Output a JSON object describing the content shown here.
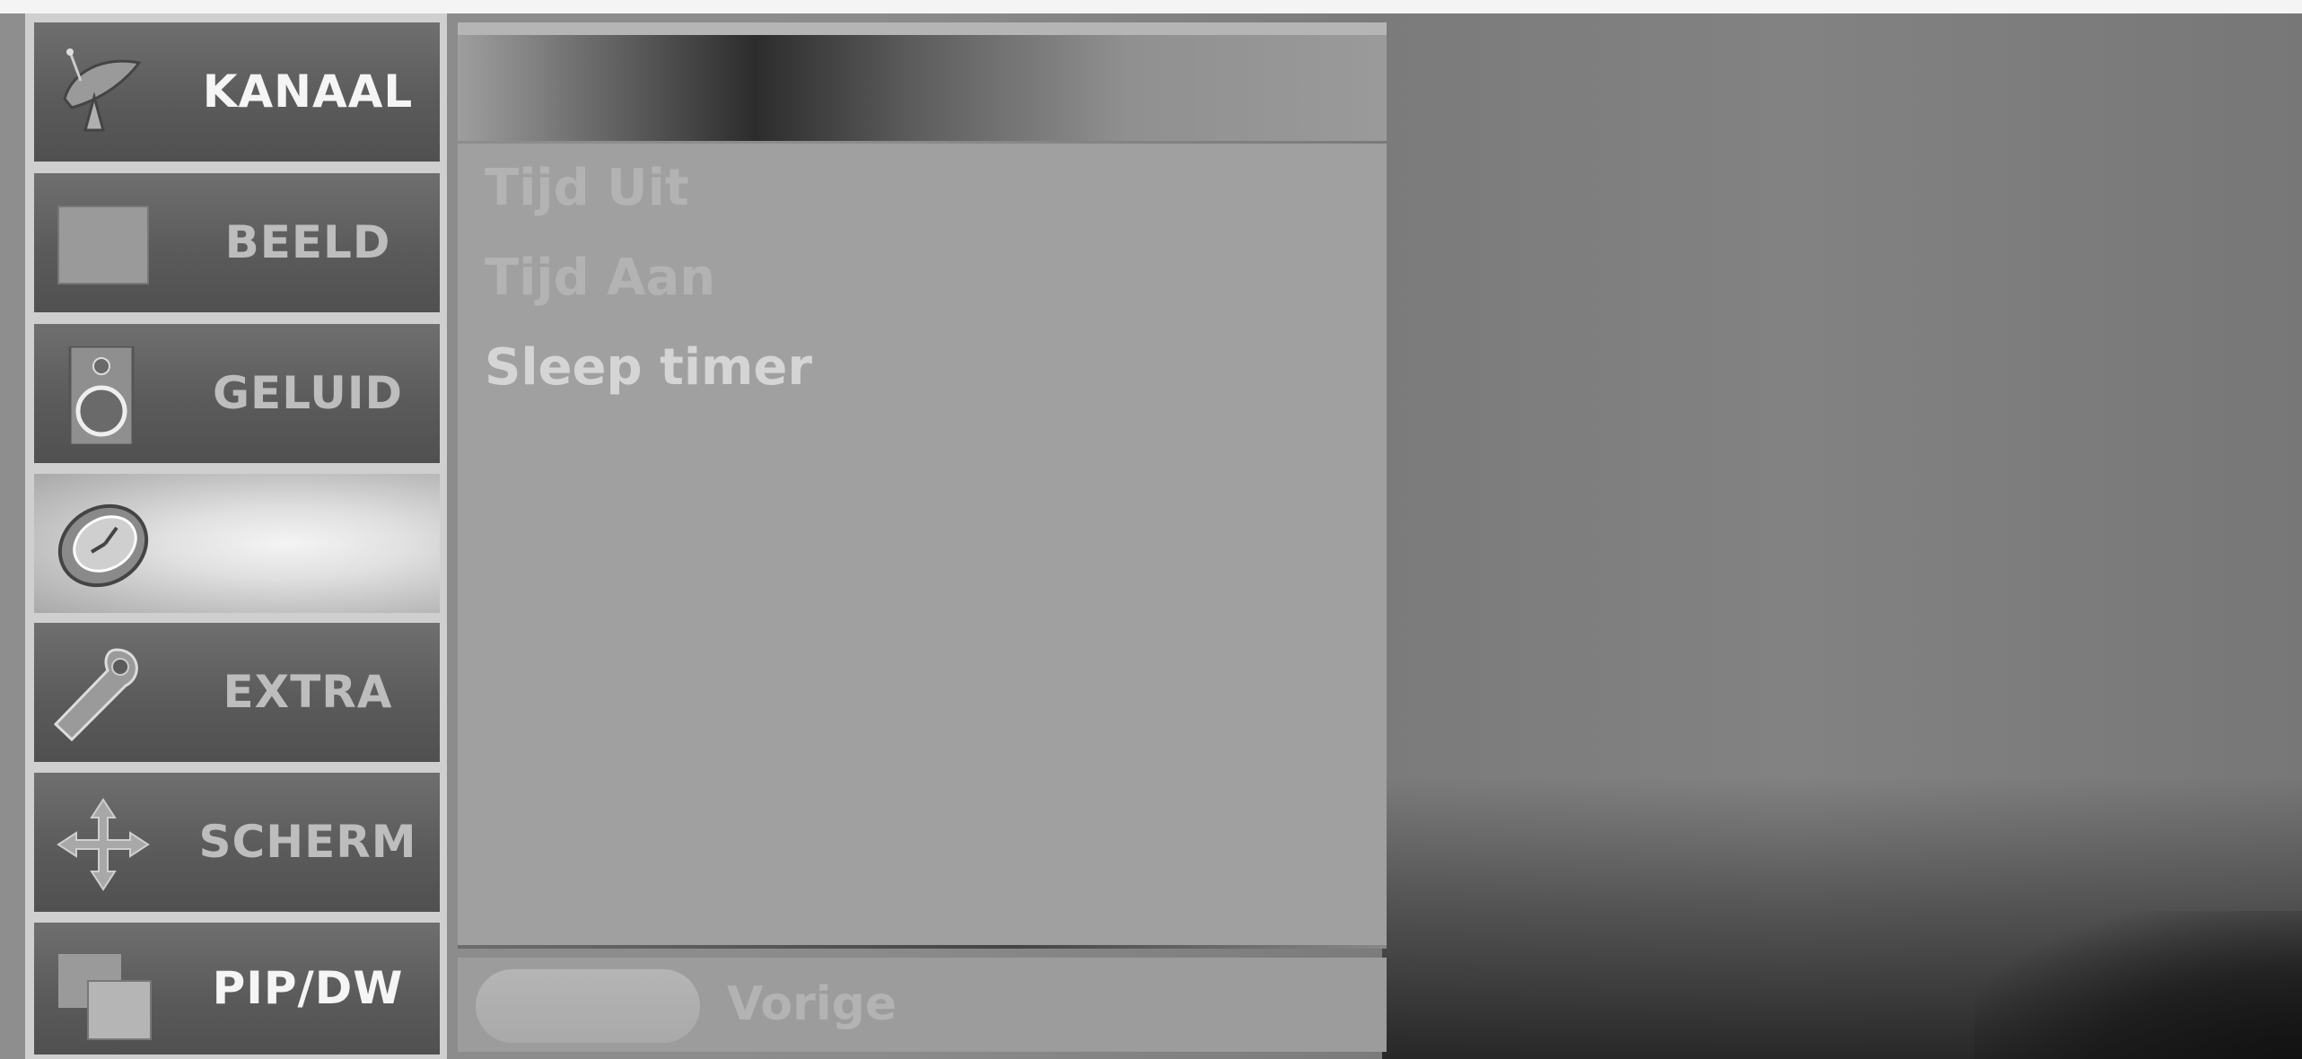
{
  "sidebar": {
    "items": [
      {
        "label": "KANAAL",
        "icon": "satellite-dish-icon"
      },
      {
        "label": "BEELD",
        "icon": "picture-square-icon"
      },
      {
        "label": "GELUID",
        "icon": "speaker-icon"
      },
      {
        "label": "",
        "icon": "clock-icon",
        "active": true
      },
      {
        "label": "EXTRA",
        "icon": "tag-icon"
      },
      {
        "label": "SCHERM",
        "icon": "move-arrows-icon"
      },
      {
        "label": "PIP/DW",
        "icon": "pip-windows-icon"
      }
    ]
  },
  "submenu": {
    "items": [
      {
        "label": "Tijd Uit"
      },
      {
        "label": "Tijd Aan"
      },
      {
        "label": "Sleep timer"
      }
    ]
  },
  "footer": {
    "label": "Vorige"
  },
  "colors": {
    "panel": "#a0a0a0",
    "tab": "#5b5b5b",
    "active_tab": "#e6e6e6",
    "background": "#8b8b8b"
  }
}
